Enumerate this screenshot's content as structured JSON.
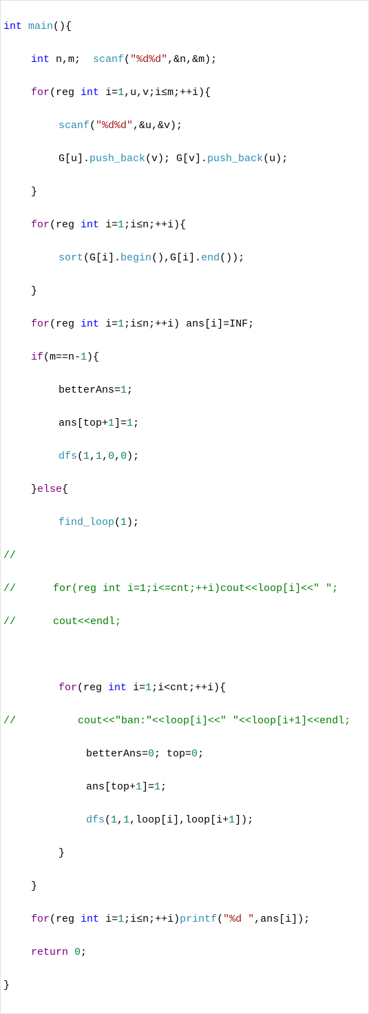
{
  "code": {
    "l1_int": "int",
    "l1_main": " main",
    "l1_rest": "(){",
    "l2_int": "int",
    "l2_vars": " n,m; ",
    "l2_scanf": " scanf",
    "l2_open": "(",
    "l2_str": "\"%d%d\"",
    "l2_args": ",&n,&m);",
    "l3_for": "for",
    "l3_open": "(",
    "l3_reg": "reg ",
    "l3_int": "int",
    "l3_rest": " i=",
    "l3_one": "1",
    "l3_uvt": ",u,v;i≤m;++i){",
    "l4_scanf": "scanf",
    "l4_open": "(",
    "l4_str": "\"%d%d\"",
    "l4_args": ",&u,&v);",
    "l5_a": "G[u].",
    "l5_pb1": "push_back",
    "l5_b": "(v); G[v].",
    "l5_pb2": "push_back",
    "l5_c": "(u);",
    "l6_close": "}",
    "l7_for": "for",
    "l7_open": "(",
    "l7_reg": "reg ",
    "l7_int": "int",
    "l7_rest": " i=",
    "l7_one": "1",
    "l7_cond": ";i≤n;++i){",
    "l8_sort": "sort",
    "l8_a": "(G[i].",
    "l8_begin": "begin",
    "l8_b": "(),G[i].",
    "l8_end": "end",
    "l8_c": "());",
    "l9_close": "}",
    "l10_for": "for",
    "l10_open": "(",
    "l10_reg": "reg ",
    "l10_int": "int",
    "l10_a": " i=",
    "l10_one": "1",
    "l10_b": ";i≤n;++i) ans[i]=INF;",
    "l11_if": "if",
    "l11_a": "(m==n-",
    "l11_one": "1",
    "l11_b": "){",
    "l12_a": "betterAns=",
    "l12_one": "1",
    "l12_b": ";",
    "l13_a": "ans[top+",
    "l13_one": "1",
    "l13_b": "]=",
    "l13_one2": "1",
    "l13_c": ";",
    "l14_dfs": "dfs",
    "l14_a": "(",
    "l14_n1": "1",
    "l14_b": ",",
    "l14_n2": "1",
    "l14_c": ",",
    "l14_n3": "0",
    "l14_d": ",",
    "l14_n4": "0",
    "l14_e": ");",
    "l15_a": "}",
    "l15_else": "else",
    "l15_b": "{",
    "l16_find": "find_loop",
    "l16_a": "(",
    "l16_one": "1",
    "l16_b": ");",
    "l17": "//",
    "l18": "//      for(reg int i=1;i<=cnt;++i)cout<<loop[i]<<\" \";",
    "l19": "//      cout<<endl;",
    "l20_for": "for",
    "l20_open": "(",
    "l20_reg": "reg ",
    "l20_int": "int",
    "l20_a": " i=",
    "l20_one": "1",
    "l20_b": ";i<cnt;++i){",
    "l21": "//          cout<<\"ban:\"<<loop[i]<<\" \"<<loop[i+1]<<endl;",
    "l22_a": "betterAns=",
    "l22_z": "0",
    "l22_b": "; top=",
    "l22_z2": "0",
    "l22_c": ";",
    "l23_a": "ans[top+",
    "l23_one": "1",
    "l23_b": "]=",
    "l23_one2": "1",
    "l23_c": ";",
    "l24_dfs": "dfs",
    "l24_a": "(",
    "l24_n1": "1",
    "l24_b": ",",
    "l24_n2": "1",
    "l24_c": ",loop[i],loop[i+",
    "l24_n3": "1",
    "l24_d": "]);",
    "l25_close": "}",
    "l26_close": "}",
    "l27_for": "for",
    "l27_open": "(",
    "l27_reg": "reg ",
    "l27_int": "int",
    "l27_a": " i=",
    "l27_one": "1",
    "l27_b": ";i≤n;++i)",
    "l27_printf": "printf",
    "l27_c": "(",
    "l27_str": "\"%d \"",
    "l27_d": ",ans[i]);",
    "l28_ret": "return",
    "l28_sp": " ",
    "l28_zero": "0",
    "l28_semi": ";",
    "l29": "}"
  }
}
